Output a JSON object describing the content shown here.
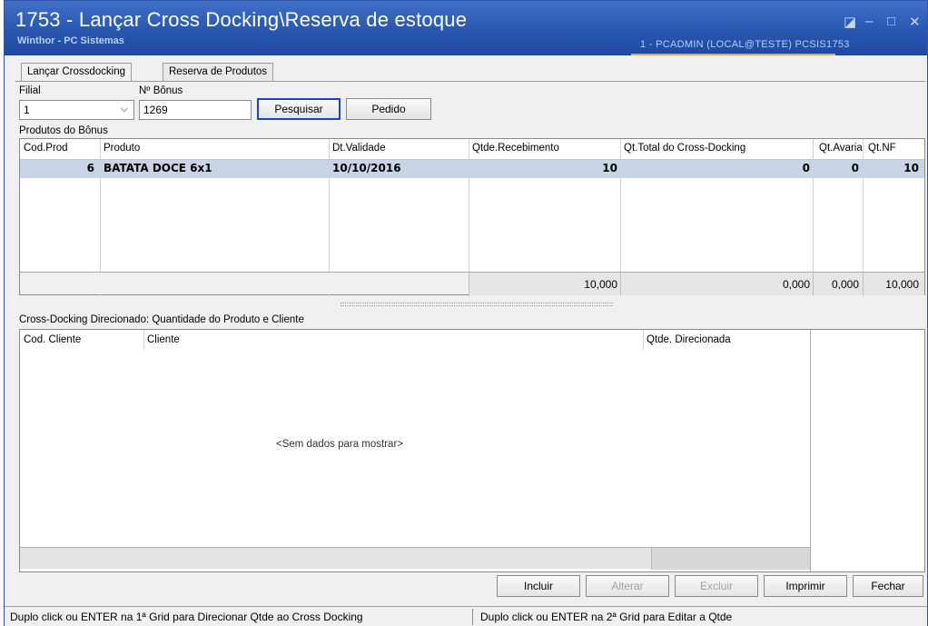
{
  "window": {
    "title": "1753 - Lançar Cross Docking\\Reserva de estoque",
    "subtitle": "Winthor - PC Sistemas",
    "user_info": "1 - PCADMIN (LOCAL@TESTE)   PCSIS1753",
    "controls": {
      "restore": "◪",
      "minimize": "–",
      "maximize": "□",
      "close": "✕"
    }
  },
  "tabs": [
    {
      "label": "Lançar Crossdocking",
      "active": true
    },
    {
      "label": "Reserva de Produtos",
      "active": false
    }
  ],
  "filters": {
    "filial_label": "Filial",
    "filial_value": "1",
    "dropdown_glyph": "⌵",
    "bonus_label": "Nº Bônus",
    "bonus_value": "1269",
    "search_button": "Pesquisar",
    "order_button": "Pedido"
  },
  "products": {
    "section_label": "Produtos do Bônus",
    "columns": [
      "Cod.Prod",
      "Produto",
      "Dt.Validade",
      "Qtde.Recebimento",
      "Qt.Total do Cross-Docking",
      "Qt.Avaria",
      "Qt.NF"
    ],
    "rows": [
      {
        "cod": "6",
        "produto": "BATATA DOCE 6x1",
        "validade": "10/10/2016",
        "recebimento": "10",
        "total_cross": "0",
        "avaria": "0",
        "nf": "10"
      }
    ],
    "totals": {
      "recebimento": "10,000",
      "total_cross": "0,000",
      "avaria": "0,000",
      "nf": "10,000"
    }
  },
  "directed": {
    "section_label": "Cross-Docking Direcionado: Quantidade do Produto e Cliente",
    "columns": [
      "Cod. Cliente",
      "Cliente",
      "Qtde. Direcionada"
    ],
    "empty_text": "<Sem dados para mostrar>"
  },
  "actions": {
    "include": "Incluir",
    "edit": "Alterar",
    "delete": "Excluir",
    "print": "Imprimir",
    "close": "Fechar"
  },
  "status": {
    "left": "Duplo click ou ENTER na 1ª Grid para Direcionar Qtde ao Cross Docking",
    "right": "Duplo click ou ENTER na 2ª Grid para Editar a Qtde"
  },
  "colors": {
    "titlebar": "#2857b0",
    "selected_row": "#c9d5e6",
    "focus_border": "#1b3fe0"
  }
}
